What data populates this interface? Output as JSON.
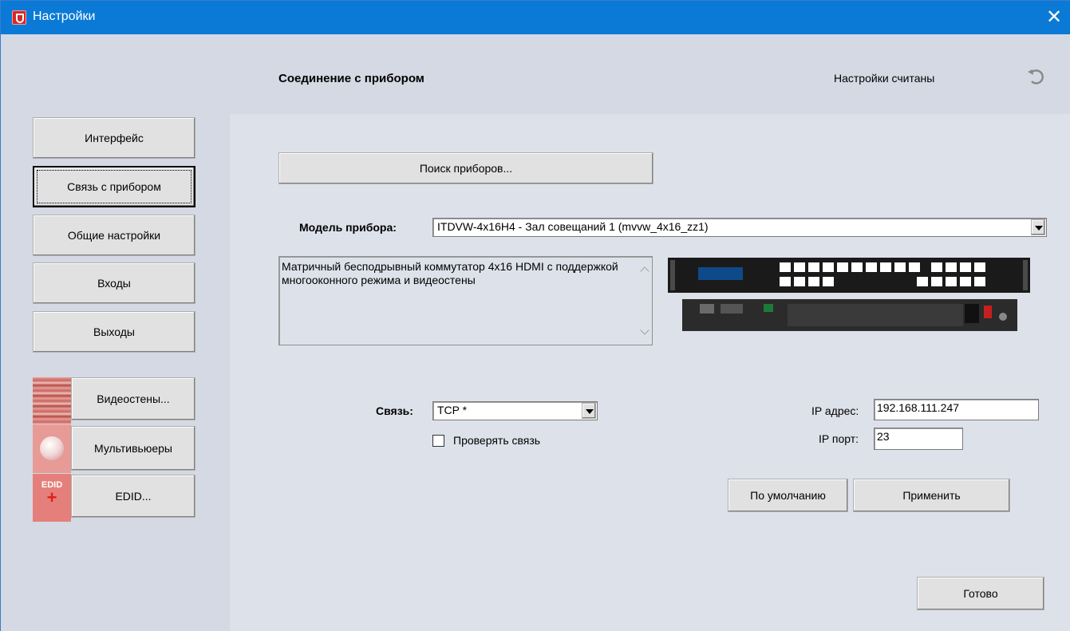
{
  "window": {
    "title": "Настройки",
    "close_glyph": "✕"
  },
  "header": {
    "page_title": "Соединение с прибором",
    "status": "Настройки считаны",
    "refresh_icon": "refresh-icon"
  },
  "sidebar": {
    "items": [
      {
        "label": "Интерфейс"
      },
      {
        "label": "Связь с прибором",
        "active": true
      },
      {
        "label": "Общие настройки"
      },
      {
        "label": "Входы"
      },
      {
        "label": "Выходы"
      }
    ],
    "tools": [
      {
        "label": "Видеостены...",
        "icon": "videowall-icon"
      },
      {
        "label": "Мультивьюеры",
        "icon": "multiviewer-icon"
      },
      {
        "label": "EDID...",
        "icon": "edid-icon",
        "icon_text": "EDID",
        "icon_plus": "+"
      }
    ]
  },
  "main": {
    "search_button": "Поиск приборов...",
    "model_label": "Модель прибора:",
    "model_value": "ITDVW-4x16H4 - Зал совещаний 1 (mvvw_4x16_zz1)",
    "description": "Матричный бесподрывный коммутатор 4x16 HDMI с поддержкой многооконного режима и видеостены",
    "connection_label": "Связь:",
    "connection_value": "TCP *",
    "check_connection_label": "Проверять связь",
    "check_connection_checked": false,
    "ip_address_label": "IP адрес:",
    "ip_address_value": "192.168.111.247",
    "ip_port_label": "IP порт:",
    "ip_port_value": "23",
    "default_button": "По умолчанию",
    "apply_button": "Применить",
    "done_button": "Готово"
  },
  "colors": {
    "titlebar": "#0a7ad6",
    "app_icon": "#d22a2a",
    "panel": "#dde1ea"
  }
}
